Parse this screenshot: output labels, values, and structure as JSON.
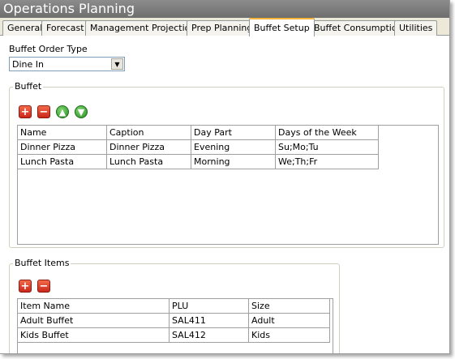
{
  "window": {
    "title": "Operations Planning"
  },
  "tabs": [
    {
      "label": "General"
    },
    {
      "label": "Forecast"
    },
    {
      "label": "Management Projection"
    },
    {
      "label": "Prep Planning"
    },
    {
      "label": "Buffet Setup",
      "active": true
    },
    {
      "label": "Buffet Consumption"
    },
    {
      "label": "Utilities"
    }
  ],
  "order_type": {
    "label": "Buffet Order Type",
    "value": "Dine In"
  },
  "buffet": {
    "label": "Buffet",
    "toolbar": [
      "add-icon",
      "remove-icon",
      "move-up-icon",
      "move-down-icon"
    ],
    "columns": [
      "Name",
      "Caption",
      "Day Part",
      "Days of the Week"
    ],
    "rows": [
      [
        "Dinner Pizza",
        "Dinner Pizza",
        "Evening",
        "Su;Mo;Tu"
      ],
      [
        "Lunch Pasta",
        "Lunch Pasta",
        "Morning",
        "We;Th;Fr"
      ]
    ]
  },
  "buffet_items": {
    "label": "Buffet Items",
    "toolbar": [
      "add-icon",
      "remove-icon"
    ],
    "columns": [
      "Item Name",
      "PLU",
      "Size"
    ],
    "rows": [
      [
        "Adult Buffet",
        "SAL411",
        "Adult"
      ],
      [
        "Kids Buffet",
        "SAL412",
        "Kids"
      ]
    ]
  },
  "colors": {
    "titlebar": "#7a7a7a",
    "tab_active_accent": "#f7b43a",
    "add_remove": "#d9361f",
    "move": "#3da834"
  }
}
